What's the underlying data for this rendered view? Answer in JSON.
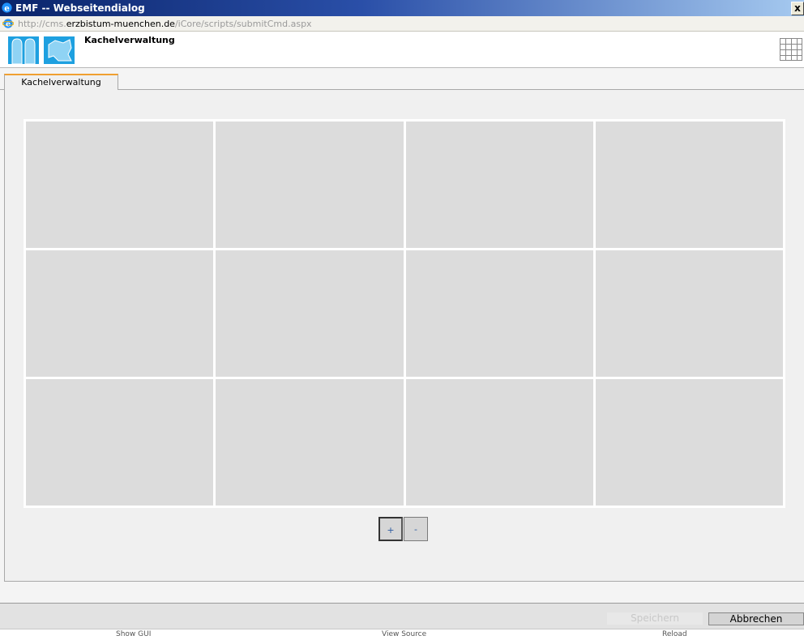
{
  "window": {
    "title": "EMF -- Webseitendialog",
    "close_glyph": "x"
  },
  "address": {
    "prefix": "http://cms.",
    "host": "erzbistum-muenchen.de",
    "path": "/iCore/scripts/submitCmd.aspx"
  },
  "header": {
    "title": "Kachelverwaltung",
    "logo_icon": "church-windows-logo",
    "grid_icon": "tile-grid-icon"
  },
  "tabs": [
    {
      "label": "Kachelverwaltung",
      "active": true
    }
  ],
  "tiles": {
    "rows": 3,
    "cols": 4,
    "color": "#dcdcdc"
  },
  "controls": {
    "add_label": "+",
    "remove_label": "-"
  },
  "footer": {
    "save_label": "Speichern",
    "cancel_label": "Abbrechen"
  },
  "statusbar": {
    "show_gui": "Show GUI",
    "view_source": "View Source",
    "reload": "Reload"
  }
}
